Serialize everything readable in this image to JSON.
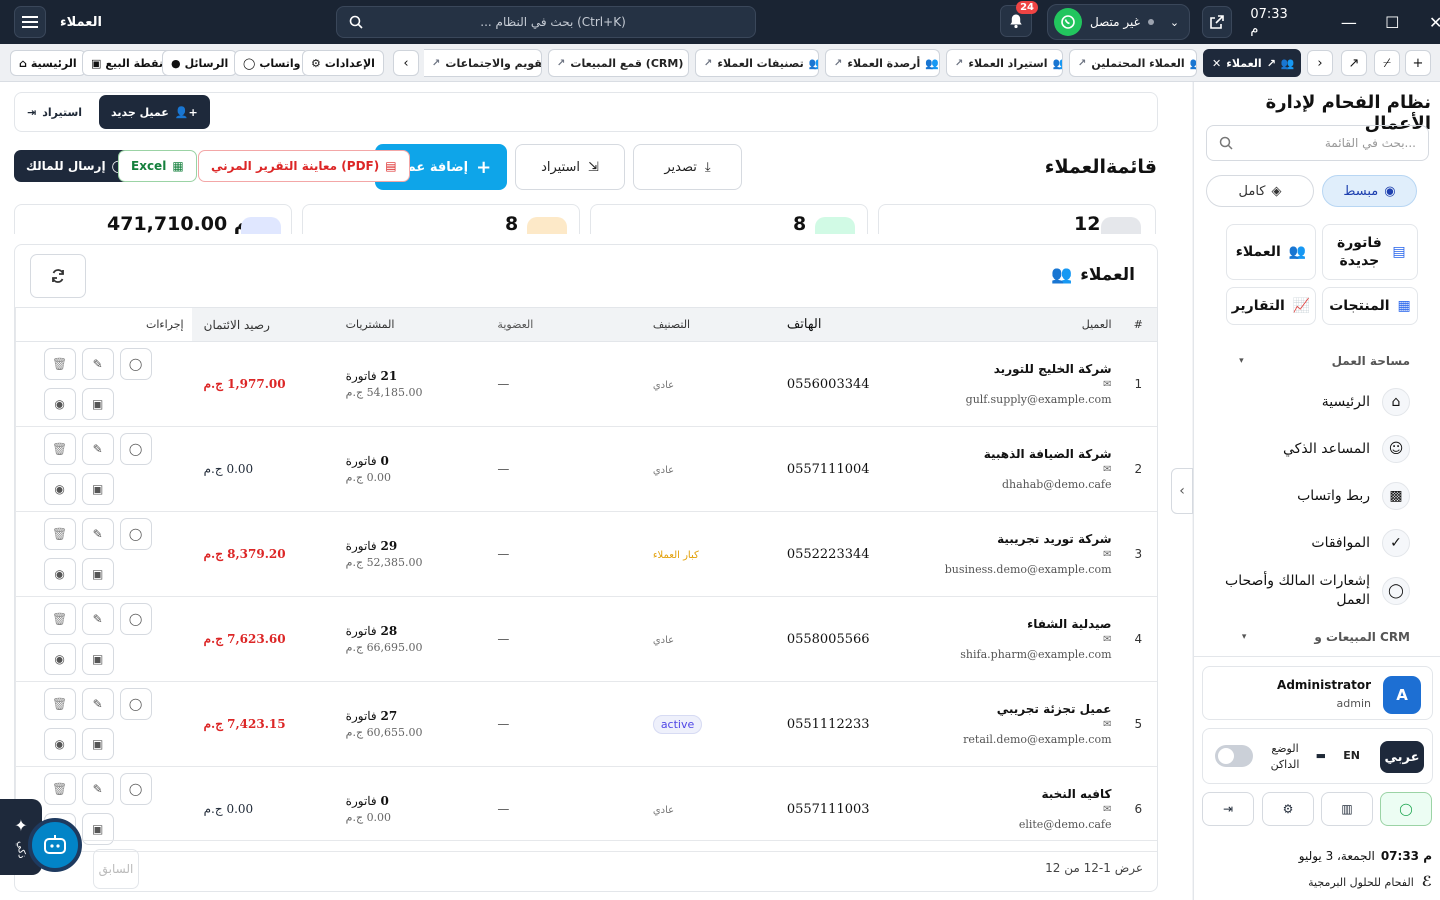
{
  "topbar": {
    "app_label": "العملاء",
    "search_placeholder": "... بحث في النظام (Ctrl+K)",
    "notif_count": "24",
    "wa_status": "غير متصل",
    "time": "07:33 م"
  },
  "quick": {
    "home": "الرئيسية",
    "pos": "نقطة البيع",
    "messages": "الرسائل",
    "whatsapp": "واتساب",
    "settings": "الإعدادات"
  },
  "tabs": [
    {
      "label": "التقويم والاجتماعات"
    },
    {
      "label": "قمع المبيعات (CRM)"
    },
    {
      "label": "تصنيفات العملاء"
    },
    {
      "label": "أرصدة العملاء"
    },
    {
      "label": "استيراد العملاء"
    },
    {
      "label": "العملاء المحتملين"
    },
    {
      "label": "العملاء"
    }
  ],
  "main": {
    "new_customer": "عميل جديد",
    "import_small": "استيراد",
    "page_title": "قائمةالعملاء",
    "add_customer": "إضافة عميل",
    "import": "استيراد",
    "export": "تصدير",
    "excel": "Excel",
    "pdf": "معاينة التقرير المرني (PDF)",
    "send_owner": "إرسال للمالك",
    "stats": [
      "471,710.00 ج.م",
      "8",
      "8",
      "12"
    ],
    "customers_title": "العملاء",
    "columns": [
      "#",
      "العميل",
      "الهاتف",
      "التصنيف",
      "العضوية",
      "المشتريات",
      "رصيد الائتمان",
      "إجراءات"
    ],
    "rows": [
      {
        "n": "1",
        "name": "شركة الخليج للتوريد",
        "email": "gulf.supply@example.com",
        "phone": "0556003344",
        "cls": "عادي",
        "cls_type": "normal",
        "mem": "—",
        "pur_count": "21",
        "pur_unit": "فاتورة",
        "pur_total": "54,185.00 ج.م",
        "bal": "1,977.00 ج.م",
        "bal_red": true
      },
      {
        "n": "2",
        "name": "شركة الضيافة الذهبية",
        "email": "dhahab@demo.cafe",
        "phone": "0557111004",
        "cls": "عادي",
        "cls_type": "normal",
        "mem": "—",
        "pur_count": "0",
        "pur_unit": "فاتورة",
        "pur_total": "0.00 ج.م",
        "bal": "0.00 ج.م",
        "bal_red": false
      },
      {
        "n": "3",
        "name": "شركة توريد تجريبية",
        "email": "business.demo@example.com",
        "phone": "0552223344",
        "cls": "كبار العملاء",
        "cls_type": "vip",
        "mem": "—",
        "pur_count": "29",
        "pur_unit": "فاتورة",
        "pur_total": "52,385.00 ج.م",
        "bal": "8,379.20 ج.م",
        "bal_red": true
      },
      {
        "n": "4",
        "name": "صيدلية الشفاء",
        "email": "shifa.pharm@example.com",
        "phone": "0558005566",
        "cls": "عادي",
        "cls_type": "normal",
        "mem": "—",
        "pur_count": "28",
        "pur_unit": "فاتورة",
        "pur_total": "66,695.00 ج.م",
        "bal": "7,623.60 ج.م",
        "bal_red": true
      },
      {
        "n": "5",
        "name": "عميل تجزئة تجريبي",
        "email": "retail.demo@example.com",
        "phone": "0551112233",
        "cls": "active",
        "cls_type": "active",
        "mem": "—",
        "pur_count": "27",
        "pur_unit": "فاتورة",
        "pur_total": "60,655.00 ج.م",
        "bal": "7,423.15 ج.م",
        "bal_red": true
      },
      {
        "n": "6",
        "name": "كافيه النخبة",
        "email": "elite@demo.cafe",
        "phone": "0557111003",
        "cls": "عادي",
        "cls_type": "normal",
        "mem": "—",
        "pur_count": "0",
        "pur_unit": "فاتورة",
        "pur_total": "0.00 ج.م",
        "bal": "0.00 ج.م",
        "bal_red": false
      }
    ],
    "showing": "عرض 1-12 من 12",
    "prev": "السابق",
    "ai_label": "ذكي"
  },
  "sidebar": {
    "title": "نظام الفحام لإدارة الأعمال",
    "search_placeholder": "بحث في القائمة...",
    "mode_simple": "مبسط",
    "mode_full": "كامل",
    "new_invoice": "فاتورة جديدة",
    "customers": "العملاء",
    "products": "المنتجات",
    "reports": "التقارير",
    "section_workspace": "مساحة العمل",
    "nav": [
      "الرئيسية",
      "المساعد الذكي",
      "ربط واتساب",
      "الموافقات",
      "إشعارات المالك وأصحاب العمل"
    ],
    "section_sales": "المبيعات و CRM",
    "user_name": "Administrator",
    "user_role": "admin",
    "avatar_letter": "A",
    "lang_ar": "عربي",
    "lang_en": "EN",
    "dark_mode": "الوضع الداكن",
    "time": "07:33 م",
    "date": "الجمعة، 3 يوليو",
    "brand": "الفحام للحلول البرمجية"
  },
  "colors": {
    "accent": "#0ea5e9",
    "dark": "#1e293b",
    "danger": "#dc2626",
    "whatsapp": "#22c55e"
  }
}
